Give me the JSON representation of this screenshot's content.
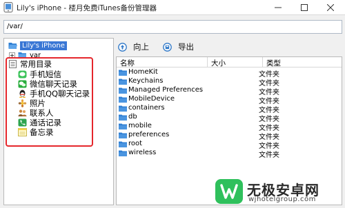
{
  "window": {
    "title": "Lily's iPhone - 楼月免费iTunes备份管理器"
  },
  "path_bar": {
    "value": "/var/"
  },
  "tree": {
    "root_label": "Lily's iPhone",
    "child_label": "var"
  },
  "common": {
    "header": "常用目录",
    "items": [
      {
        "label": "手机短信",
        "icon": "sms-icon"
      },
      {
        "label": "微信聊天记录",
        "icon": "wechat-icon"
      },
      {
        "label": "手机QQ聊天记录",
        "icon": "qq-icon"
      },
      {
        "label": "照片",
        "icon": "photos-icon"
      },
      {
        "label": "联系人",
        "icon": "contacts-icon"
      },
      {
        "label": "通话记录",
        "icon": "phone-icon"
      },
      {
        "label": "备忘录",
        "icon": "notes-icon"
      }
    ]
  },
  "toolbar": {
    "up_label": "向上",
    "export_label": "导出"
  },
  "list": {
    "columns": {
      "name": "名称",
      "size": "大小",
      "type": "类型"
    },
    "rows": [
      {
        "name": "HomeKit",
        "type": "文件夹"
      },
      {
        "name": "Keychains",
        "type": "文件夹"
      },
      {
        "name": "Managed Preferences",
        "type": "文件夹"
      },
      {
        "name": "MobileDevice",
        "type": "文件夹"
      },
      {
        "name": "containers",
        "type": "文件夹"
      },
      {
        "name": "db",
        "type": "文件夹"
      },
      {
        "name": "mobile",
        "type": "文件夹"
      },
      {
        "name": "preferences",
        "type": "文件夹"
      },
      {
        "name": "root",
        "type": "文件夹"
      },
      {
        "name": "wireless",
        "type": "文件夹"
      }
    ]
  },
  "watermark": {
    "title": "无极安卓网",
    "url": "wjhotelgroup.com"
  },
  "colors": {
    "selection": "#3a77d5",
    "highlight_box": "#e5262b",
    "folder": "#2f7fd3",
    "watermark_green": "#2fc05c"
  }
}
